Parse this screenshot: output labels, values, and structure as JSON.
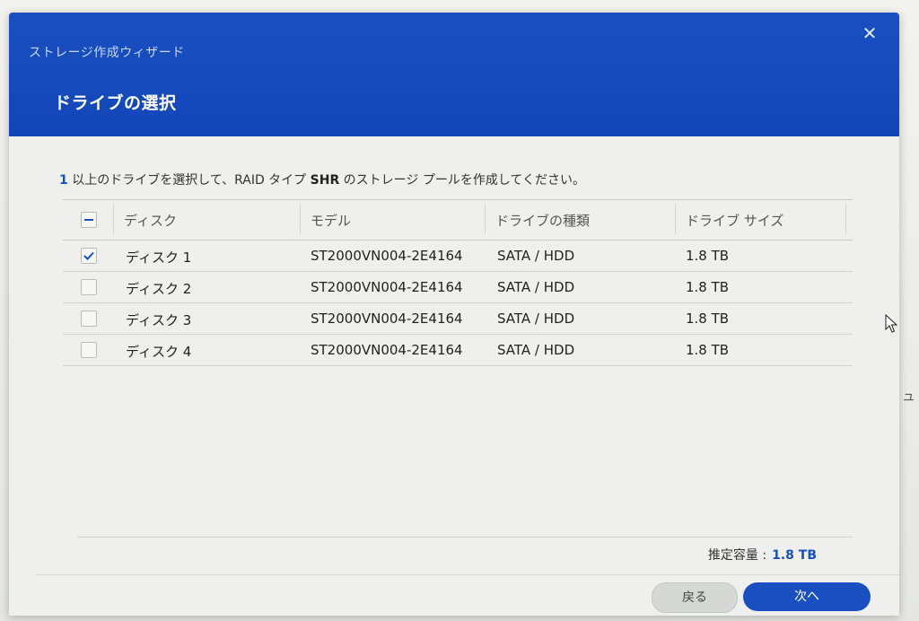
{
  "dialog": {
    "wizard_title": "ストレージ作成ウィザード",
    "close_glyph": "✕",
    "step_title": "ドライブの選択"
  },
  "instruction": {
    "count": "1",
    "part1": " 以上のドライブを選択して、RAID タイプ ",
    "raid_type": "SHR",
    "part2": " のストレージ プールを作成してください。"
  },
  "table": {
    "columns": {
      "disk": "ディスク",
      "model": "モデル",
      "type": "ドライブの種類",
      "size": "ドライブ サイズ"
    },
    "rows": [
      {
        "disk": "ディスク 1",
        "model": "ST2000VN004-2E4164",
        "type": "SATA / HDD",
        "size": "1.8 TB",
        "checked": true
      },
      {
        "disk": "ディスク 2",
        "model": "ST2000VN004-2E4164",
        "type": "SATA / HDD",
        "size": "1.8 TB",
        "checked": false
      },
      {
        "disk": "ディスク 3",
        "model": "ST2000VN004-2E4164",
        "type": "SATA / HDD",
        "size": "1.8 TB",
        "checked": false
      },
      {
        "disk": "ディスク 4",
        "model": "ST2000VN004-2E4164",
        "type": "SATA / HDD",
        "size": "1.8 TB",
        "checked": false
      }
    ]
  },
  "capacity": {
    "label": "推定容量 :",
    "value": "1.8 TB"
  },
  "buttons": {
    "back": "戻る",
    "next": "次へ"
  },
  "backdrop_text": "リュ",
  "colors": {
    "accent": "#1a4fc2",
    "content_bg": "#eff0ee"
  }
}
